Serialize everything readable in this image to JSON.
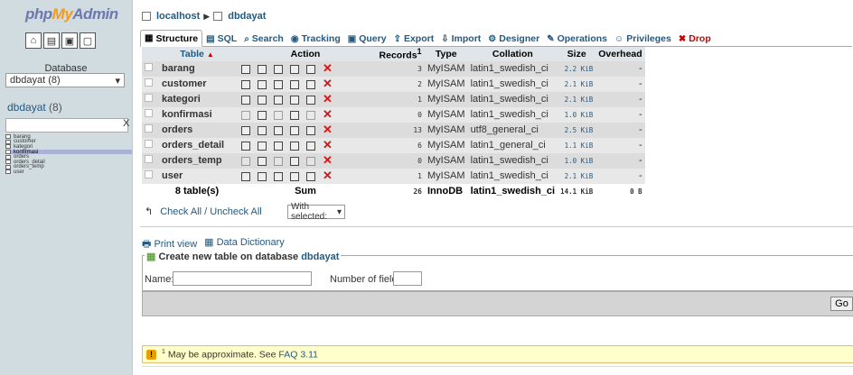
{
  "nav": {
    "logo": {
      "php": "php",
      "my": "My",
      "admin": "Admin"
    },
    "quick_icons": [
      "home-icon",
      "sql-icon",
      "docs-icon",
      "reload-icon"
    ],
    "database_label": "Database",
    "database_select": "dbdayat (8)",
    "db_name": "dbdayat",
    "db_count": "(8)",
    "filter_clear": "X",
    "tables": [
      "barang",
      "customer",
      "kategori",
      "konfirmasi",
      "orders",
      "orders_detail",
      "orders_temp",
      "user"
    ],
    "active_table": "konfirmasi"
  },
  "breadcrumb": {
    "server": "localhost",
    "database": "dbdayat"
  },
  "tabs": [
    {
      "label": "Structure",
      "icon": "structure-icon"
    },
    {
      "label": "SQL",
      "icon": "sql-icon"
    },
    {
      "label": "Search",
      "icon": "search-icon"
    },
    {
      "label": "Tracking",
      "icon": "tracking-icon"
    },
    {
      "label": "Query",
      "icon": "query-icon"
    },
    {
      "label": "Export",
      "icon": "export-icon"
    },
    {
      "label": "Import",
      "icon": "import-icon"
    },
    {
      "label": "Designer",
      "icon": "designer-icon"
    },
    {
      "label": "Operations",
      "icon": "operations-icon"
    },
    {
      "label": "Privileges",
      "icon": "privileges-icon"
    },
    {
      "label": "Drop",
      "icon": "drop-icon"
    }
  ],
  "table": {
    "headers": {
      "table": "Table",
      "action": "Action",
      "records": "Records",
      "records_sup": "1",
      "type": "Type",
      "collation": "Collation",
      "size": "Size",
      "overhead": "Overhead"
    },
    "rows": [
      {
        "name": "barang",
        "records": "3",
        "type": "MyISAM",
        "collation": "latin1_swedish_ci",
        "size": "2.2 KiB",
        "overhead": "-",
        "empty": false
      },
      {
        "name": "customer",
        "records": "2",
        "type": "MyISAM",
        "collation": "latin1_swedish_ci",
        "size": "2.1 KiB",
        "overhead": "-",
        "empty": false
      },
      {
        "name": "kategori",
        "records": "1",
        "type": "MyISAM",
        "collation": "latin1_swedish_ci",
        "size": "2.1 KiB",
        "overhead": "-",
        "empty": false
      },
      {
        "name": "konfirmasi",
        "records": "0",
        "type": "MyISAM",
        "collation": "latin1_swedish_ci",
        "size": "1.0 KiB",
        "overhead": "-",
        "empty": true
      },
      {
        "name": "orders",
        "records": "13",
        "type": "MyISAM",
        "collation": "utf8_general_ci",
        "size": "2.5 KiB",
        "overhead": "-",
        "empty": false
      },
      {
        "name": "orders_detail",
        "records": "6",
        "type": "MyISAM",
        "collation": "latin1_general_ci",
        "size": "1.1 KiB",
        "overhead": "-",
        "empty": false
      },
      {
        "name": "orders_temp",
        "records": "0",
        "type": "MyISAM",
        "collation": "latin1_swedish_ci",
        "size": "1.0 KiB",
        "overhead": "-",
        "empty": true
      },
      {
        "name": "user",
        "records": "1",
        "type": "MyISAM",
        "collation": "latin1_swedish_ci",
        "size": "2.1 KiB",
        "overhead": "-",
        "empty": false
      }
    ],
    "summary": {
      "tables": "8 table(s)",
      "sum": "Sum",
      "records": "26",
      "type": "InnoDB",
      "collation": "latin1_swedish_ci",
      "size": "14.1 KiB",
      "overhead": "0 B"
    }
  },
  "check_all": "Check All / Uncheck All",
  "with_selected": "With selected:",
  "links": {
    "print": "Print view",
    "dictionary": "Data Dictionary"
  },
  "create": {
    "legend": "Create new table on database",
    "db": "dbdayat",
    "name_label": "Name:",
    "fields_label": "Number of fields:",
    "go": "Go"
  },
  "notice": {
    "sup": "1",
    "text": "May be approximate. See",
    "link": "FAQ 3.11"
  }
}
